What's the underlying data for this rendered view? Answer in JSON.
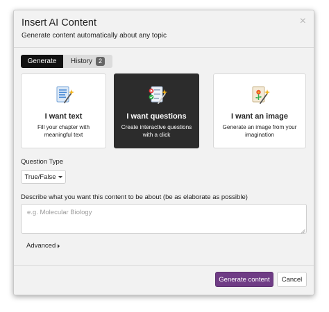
{
  "dialog": {
    "title": "Insert AI Content",
    "subtitle": "Generate content automatically about any topic",
    "close_glyph": "×"
  },
  "tabs": [
    {
      "label": "Generate",
      "active": true
    },
    {
      "label": "History",
      "badge": "2",
      "active": false
    }
  ],
  "cards": [
    {
      "label": "I want text",
      "desc": "Fill your chapter with meaningful text",
      "icon": "document-wand-icon",
      "active": false
    },
    {
      "label": "I want questions",
      "desc": "Create interactive questions with a click",
      "icon": "quiz-wand-icon",
      "active": true
    },
    {
      "label": "I want an image",
      "desc": "Generate an image from your imagination",
      "icon": "image-wand-icon",
      "active": false
    }
  ],
  "question_type": {
    "label": "Question Type",
    "selected": "True/False"
  },
  "topic": {
    "label": "Describe what you want this content to be about (be as elaborate as possible)",
    "placeholder": "e.g. Molecular Biology",
    "value": ""
  },
  "advanced_label": "Advanced",
  "footer": {
    "generate_label": "Generate content",
    "cancel_label": "Cancel"
  },
  "colors": {
    "primary": "#6f3c85",
    "active_card": "#2c2c2c",
    "dialog_bg": "#f2f2f2"
  }
}
